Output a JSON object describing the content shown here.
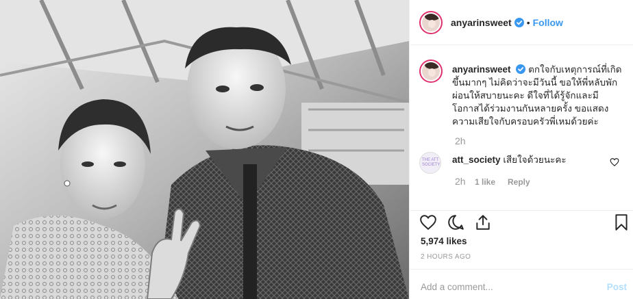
{
  "post": {
    "username": "anyarinsweet",
    "follow_label": "Follow",
    "separator": "•",
    "caption": "ตกใจกับเหตุการณ์ที่เกิดขึ้นมากๆ ไม่คิดว่าจะมีวันนี้ ขอให้พี่หลับพักผ่อนให้สบายนะคะ ดีใจที่ได้รู้จักและมีโอกาสได้ร่วมงานกันหลายครั้ง ขอแสดงความเสียใจกับครอบครัวพี่เหมด้วยค่ะ",
    "caption_time": "2h"
  },
  "comment": {
    "username": "att_society",
    "text": "เสียใจด้วยนะคะ",
    "time": "2h",
    "likes": "1 like",
    "reply_label": "Reply",
    "avatar_text": "THE ATT SOCIETY"
  },
  "stats": {
    "likes": "5,974 likes",
    "posted_ago": "2 HOURS AGO"
  },
  "composer": {
    "placeholder": "Add a comment...",
    "post_label": "Post"
  },
  "colors": {
    "accent": "#3897f0",
    "verified": "#3897f0",
    "post_disabled": "#b2dffc",
    "muted": "#999999"
  },
  "icons": [
    "verified-badge-icon",
    "heart-icon",
    "comment-icon",
    "share-icon",
    "bookmark-icon"
  ]
}
